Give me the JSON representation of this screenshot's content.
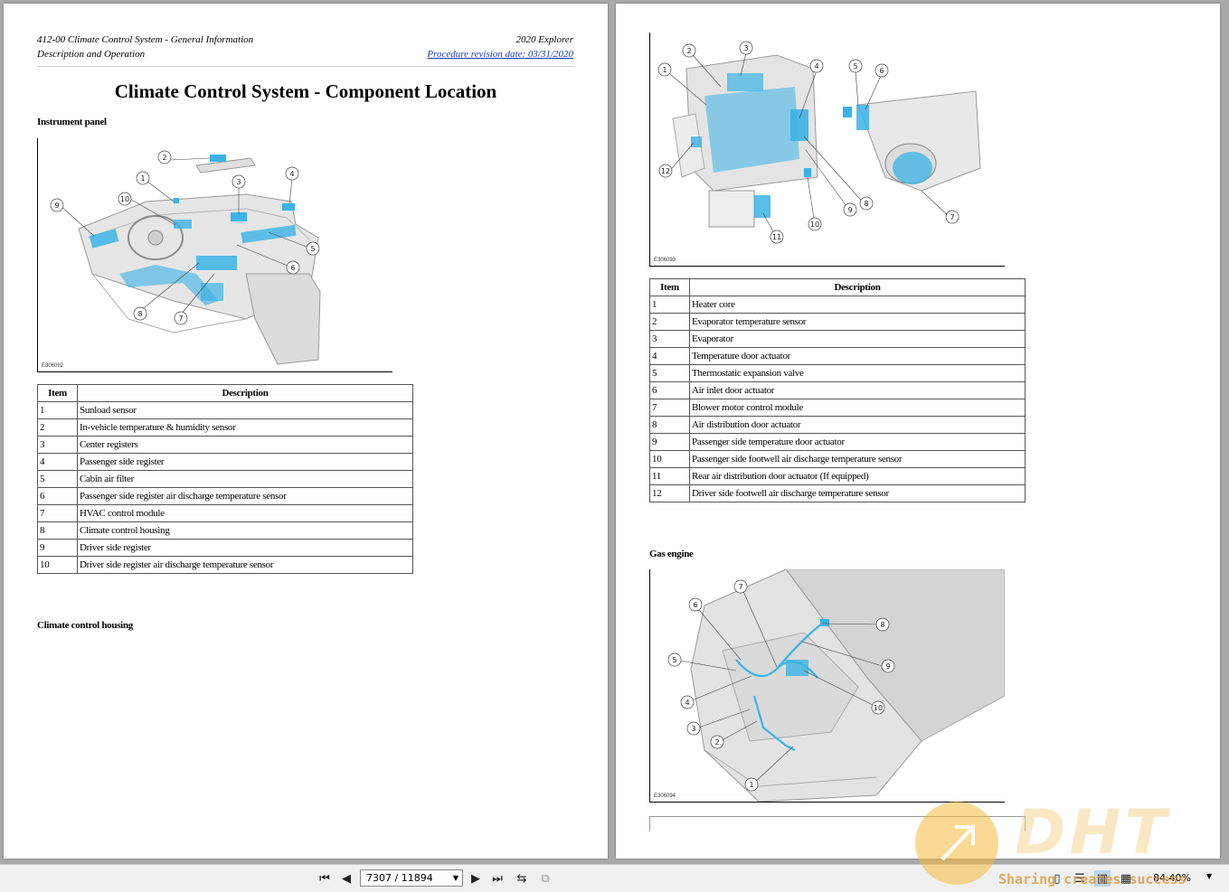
{
  "left_page": {
    "header_left_line1": "412-00 Climate Control System - General Information",
    "header_left_line2": "Description and Operation",
    "header_right_line1": "2020 Explorer",
    "header_right_line2": "Procedure revision date: 03/31/2020",
    "title": "Climate Control System - Component Location",
    "section1_heading": "Instrument panel",
    "figure1_id": "E306092",
    "table_header_item": "Item",
    "table_header_description": "Description",
    "table1_rows": [
      {
        "item": "1",
        "description": "Sunload sensor"
      },
      {
        "item": "2",
        "description": "In-vehicle temperature & humidity sensor"
      },
      {
        "item": "3",
        "description": "Center registers"
      },
      {
        "item": "4",
        "description": "Passenger side register"
      },
      {
        "item": "5",
        "description": "Cabin air filter"
      },
      {
        "item": "6",
        "description": "Passenger side register air discharge temperature sensor"
      },
      {
        "item": "7",
        "description": "HVAC control module"
      },
      {
        "item": "8",
        "description": "Climate control housing"
      },
      {
        "item": "9",
        "description": "Driver side register"
      },
      {
        "item": "10",
        "description": "Driver side register air discharge temperature sensor"
      }
    ],
    "section2_heading": "Climate control housing"
  },
  "right_page": {
    "figure2_id": "E306093",
    "table_header_item": "Item",
    "table_header_description": "Description",
    "table2_rows": [
      {
        "item": "1",
        "description": "Heater core"
      },
      {
        "item": "2",
        "description": "Evaporator temperature sensor"
      },
      {
        "item": "3",
        "description": "Evaporator"
      },
      {
        "item": "4",
        "description": "Temperature door actuator"
      },
      {
        "item": "5",
        "description": "Thermostatic expansion valve"
      },
      {
        "item": "6",
        "description": "Air inlet door actuator"
      },
      {
        "item": "7",
        "description": "Blower motor control module"
      },
      {
        "item": "8",
        "description": "Air distribution door actuator"
      },
      {
        "item": "9",
        "description": "Passenger side temperature door actuator"
      },
      {
        "item": "10",
        "description": "Passenger side footwell air discharge temperature sensor"
      },
      {
        "item": "11",
        "description": "Rear air distribution door actuator (If equipped)"
      },
      {
        "item": "12",
        "description": "Driver side footwell air discharge temperature sensor"
      }
    ],
    "section3_heading": "Gas engine",
    "figure3_id": "E306094"
  },
  "callouts": {
    "fig1": [
      "1",
      "2",
      "3",
      "4",
      "5",
      "6",
      "7",
      "8",
      "9",
      "10"
    ],
    "fig2": [
      "1",
      "2",
      "3",
      "4",
      "5",
      "6",
      "7",
      "8",
      "9",
      "10",
      "11",
      "12"
    ],
    "fig3": [
      "1",
      "2",
      "3",
      "4",
      "5",
      "6",
      "7",
      "8",
      "9",
      "10"
    ]
  },
  "toolbar": {
    "page_indicator": "7307 / 11894",
    "zoom_level": "84.40%",
    "icons": [
      "first-page-icon",
      "prev-page-icon",
      "next-page-icon",
      "last-page-icon",
      "rotate-icon",
      "export-icon",
      "single-page-icon",
      "continuous-icon",
      "two-page-icon",
      "two-page-continuous-icon"
    ]
  },
  "watermark": {
    "logo_text": "DHT",
    "tagline": "Sharing creates success"
  },
  "colors": {
    "highlight_blue": "#3bb3e6",
    "link_blue": "#1a39b6",
    "viewer_background": "#a9a9a9"
  }
}
